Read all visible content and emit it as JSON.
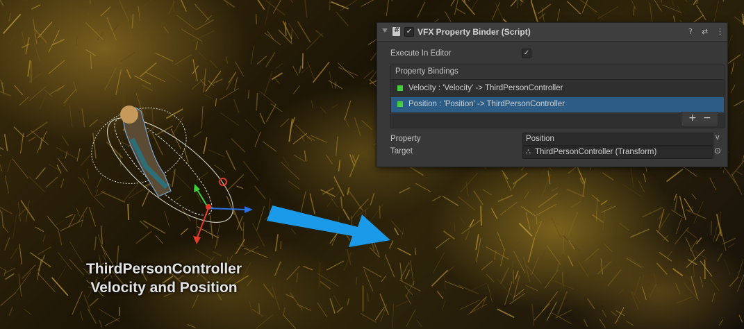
{
  "scene": {
    "caption_line1": "ThirdPersonController",
    "caption_line2": "Velocity and Position",
    "arrow_color": "#1a9ae8"
  },
  "inspector": {
    "title": "VFX Property Binder (Script)",
    "enabled_check": "✓",
    "header_icons": [
      "help-icon",
      "preset-icon",
      "more-menu-icon"
    ],
    "help_glyph": "?",
    "preset_glyph": "⇄",
    "more_glyph": "⋮",
    "execute_in_editor_label": "Execute In Editor",
    "execute_in_editor_check": "✓",
    "bindings_header": "Property Bindings",
    "bindings": [
      {
        "label": "Velocity : 'Velocity' -> ThirdPersonController",
        "selected": false
      },
      {
        "label": "Position : 'Position' -> ThirdPersonController",
        "selected": true
      }
    ],
    "add_label": "+",
    "remove_label": "−",
    "property_label": "Property",
    "property_value": "Position",
    "property_dropdown": "v",
    "target_label": "Target",
    "target_icon": "⛬",
    "target_value": "ThirdPersonController (Transform)",
    "target_picker": "⊙",
    "accent_green": "#46cf3c",
    "selected_color": "#2c5d87"
  }
}
